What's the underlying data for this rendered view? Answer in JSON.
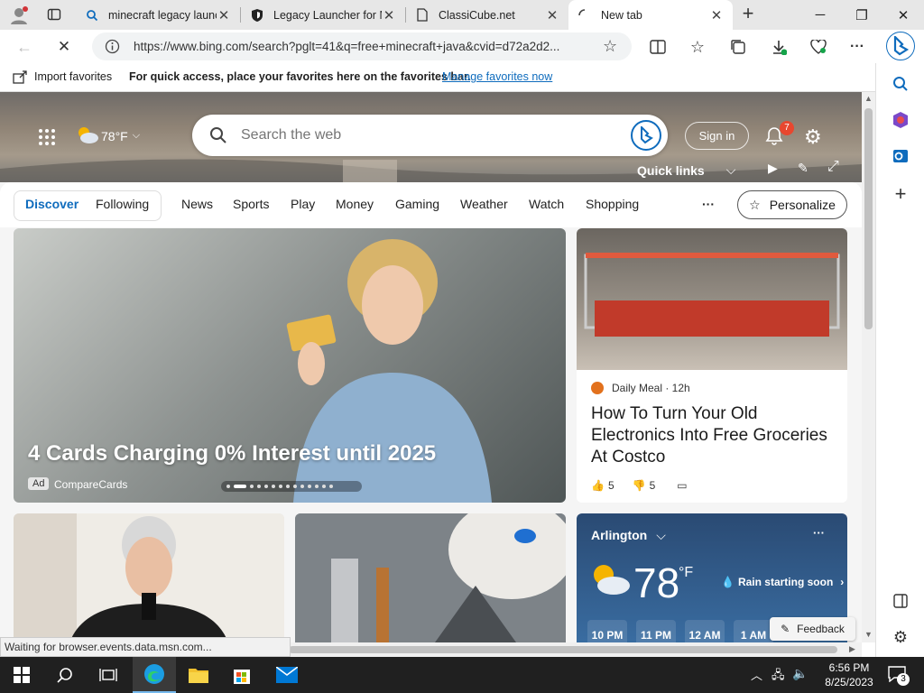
{
  "tabs": [
    {
      "label": "minecraft legacy launc",
      "icon": "search-icon"
    },
    {
      "label": "Legacy Launcher for M",
      "icon": "shield-icon"
    },
    {
      "label": "ClassiCube.net",
      "icon": "page-icon"
    },
    {
      "label": "New tab",
      "icon": "loading-icon",
      "active": true
    }
  ],
  "address": {
    "url": "https://www.bing.com/search?pglt=41&q=free+minecraft+java&cvid=d72a2d2..."
  },
  "favorites": {
    "import_label": "Import favorites",
    "hint": "For quick access, place your favorites here on the favorites bar.",
    "manage_link": "Manage favorites now"
  },
  "header": {
    "weather_temp": "78°F",
    "search_placeholder": "Search the web",
    "sign_in": "Sign in",
    "notif_count": "7",
    "quick_links": "Quick links"
  },
  "feed_tabs": [
    "Discover",
    "Following",
    "News",
    "Sports",
    "Play",
    "Money",
    "Gaming",
    "Weather",
    "Watch",
    "Shopping"
  ],
  "more": "···",
  "personalize": "Personalize",
  "hero_card": {
    "title": "4 Cards Charging 0% Interest until 2025",
    "ad_badge": "Ad",
    "source": "CompareCards"
  },
  "story_card": {
    "source": "Daily Meal · 12h",
    "title": "How To Turn Your Old Electronics Into Free Groceries At Costco",
    "likes": "5",
    "dislikes": "5"
  },
  "weather_card": {
    "location": "Arlington",
    "temp": "78",
    "unit": "°F",
    "alert": "Rain starting soon",
    "hours": [
      "10 PM",
      "11 PM",
      "12 AM",
      "1 AM"
    ],
    "feedback": "Feedback"
  },
  "status_text": "Waiting for browser.events.data.msn.com...",
  "clock": {
    "time": "6:56 PM",
    "date": "8/25/2023"
  },
  "notifications_badge": "3",
  "colors": {
    "accent": "#0f6cbd",
    "notif": "#e8472f"
  }
}
